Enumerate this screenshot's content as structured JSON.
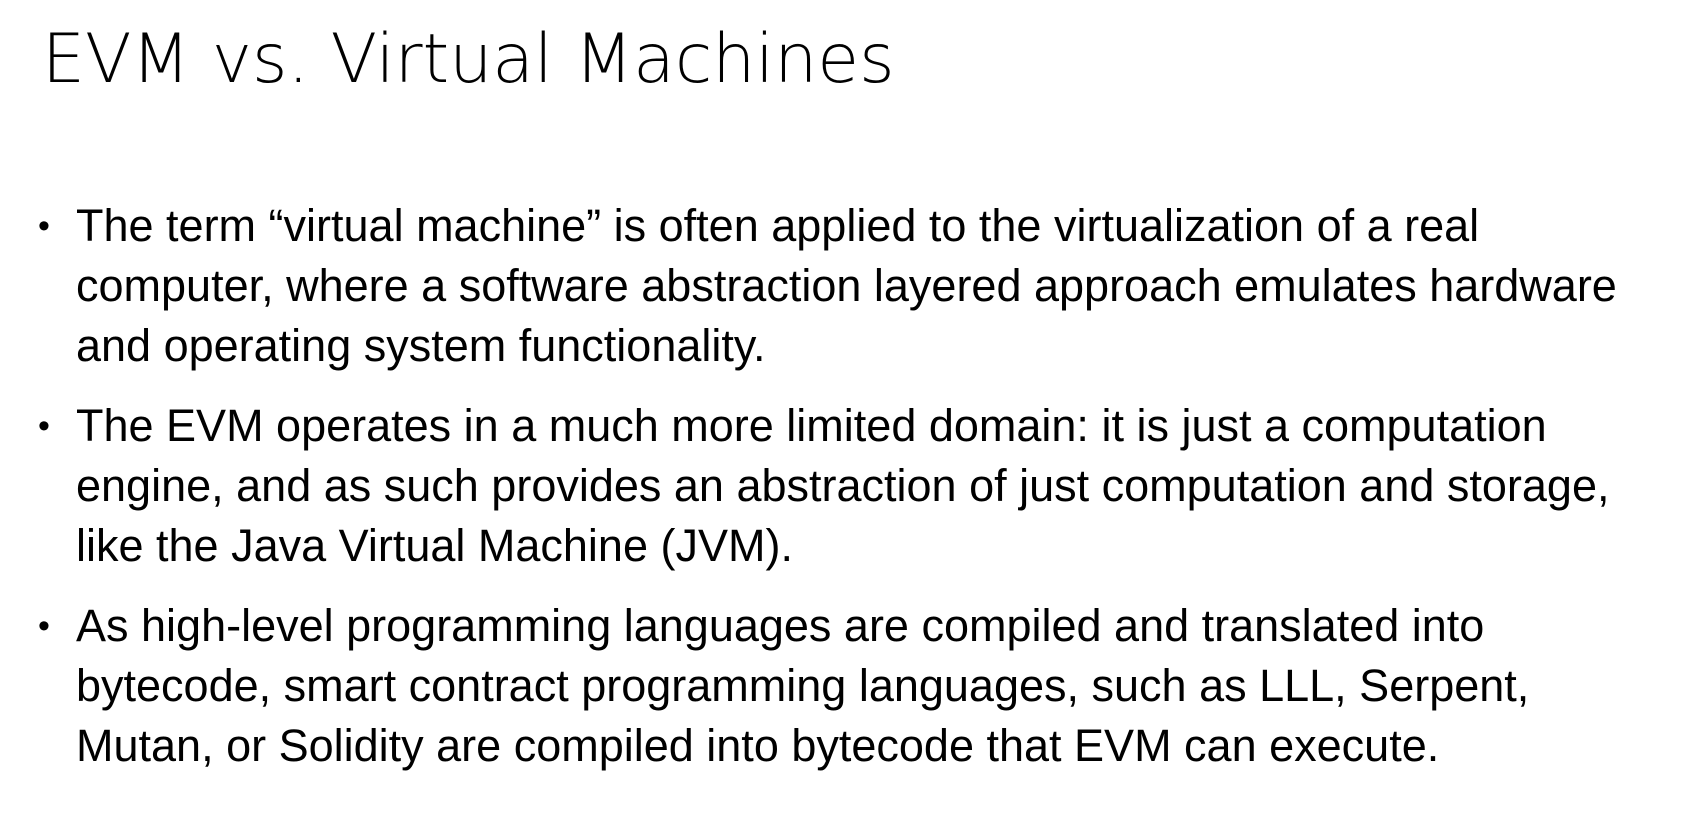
{
  "slide": {
    "title": "EVM vs. Virtual Machines",
    "bullets": [
      {
        "marker": "•",
        "text": "The term “virtual machine” is often applied to the virtualization of a real computer, where a software abstraction layered approach emulates hardware and operating system functionality."
      },
      {
        "marker": "•",
        "text": "The EVM operates in a much more limited domain: it is just a computation engine, and as such provides an abstraction of just computation and storage, like the Java Virtual Machine (JVM)."
      },
      {
        "marker": "•",
        "text": "As high-level programming languages are compiled and translated into bytecode, smart contract programming languages, such as LLL, Serpent, Mutan, or Solidity are compiled into bytecode that EVM can execute."
      }
    ]
  }
}
